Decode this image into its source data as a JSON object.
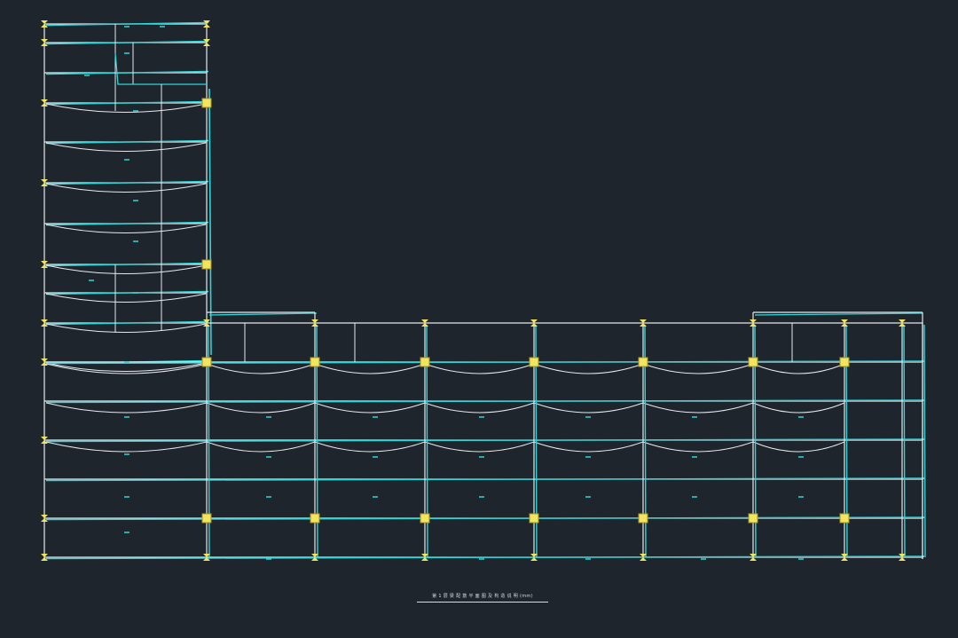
{
  "window": {
    "background": "#1f252d"
  },
  "drawing": {
    "caption": "第 1 层 梁 配 筋 平 面 图 及 构 造 说 明 (mm)",
    "colors": {
      "gridline": "#e6e9ee",
      "beam": "#2fd6d8",
      "column": "#f2e45c",
      "text": "#d8dde3"
    },
    "icons": {
      "column": "column-square-icon",
      "column_cap": "column-bowtie-icon"
    }
  }
}
